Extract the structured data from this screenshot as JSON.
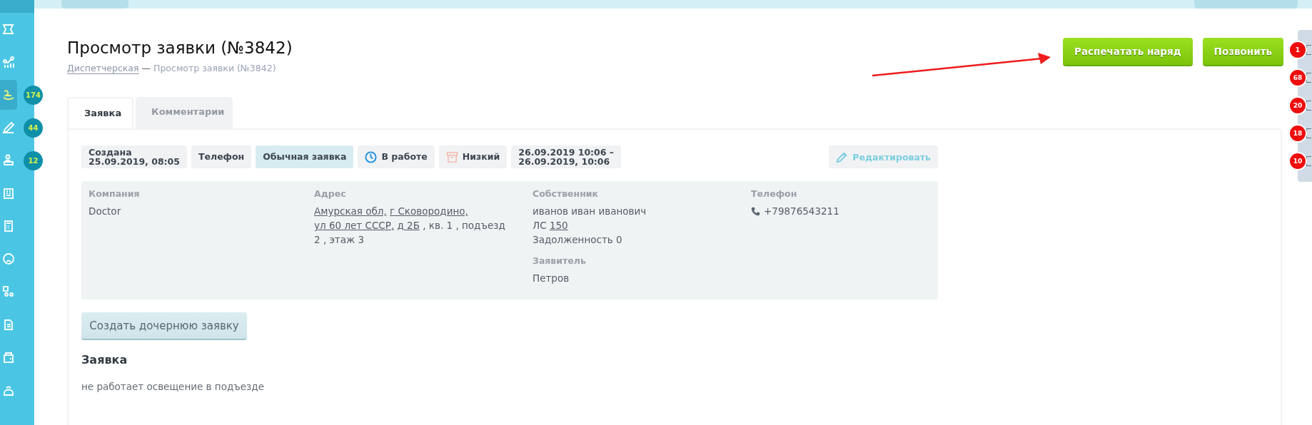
{
  "sidebar": {
    "items": [
      {
        "selected": false
      },
      {
        "selected": false
      },
      {
        "selected": true,
        "badge": "174"
      },
      {
        "selected": false,
        "badge": "44"
      },
      {
        "selected": false,
        "badge": "12"
      },
      {
        "selected": false
      },
      {
        "selected": false
      },
      {
        "selected": false
      },
      {
        "selected": false
      },
      {
        "selected": false
      },
      {
        "selected": false
      },
      {
        "selected": false
      }
    ]
  },
  "header": {
    "title": "Просмотр заявки (№3842)",
    "breadcrumb": {
      "link": "Диспетчерская",
      "separator": "—",
      "current": "Просмотр заявки (№3842)"
    },
    "buttons": [
      "Распечатать наряд",
      "Позвонить"
    ]
  },
  "tabs": [
    {
      "label": "Заявка",
      "selected": true
    },
    {
      "label": "Комментарии",
      "selected": false
    }
  ],
  "tags": [
    {
      "kind": "plain",
      "lines": [
        "Создана",
        "25.09.2019, 08:05"
      ]
    },
    {
      "kind": "plain",
      "lines": [
        "Телефон"
      ]
    },
    {
      "kind": "highlight",
      "lines": [
        "Обычная заявка"
      ]
    },
    {
      "kind": "status",
      "lines": [
        "В работе"
      ]
    },
    {
      "kind": "priority",
      "lines": [
        "Низкий"
      ]
    },
    {
      "kind": "plain",
      "lines": [
        "26.09.2019 10:06 –",
        "26.09.2019, 10:06"
      ]
    }
  ],
  "edit_button": "Редактировать",
  "info": {
    "company": {
      "label": "Компания",
      "value": "Doctor"
    },
    "address": {
      "label": "Адрес",
      "parts": [
        {
          "kind": "link",
          "text": "Амурская обл,"
        },
        {
          "kind": "link",
          "text": "г Сковородино,"
        },
        {
          "kind": "link",
          "text": "ул 60 лет СССР,"
        },
        {
          "kind": "link",
          "text": "д 2Б"
        },
        {
          "kind": "text",
          "text": ", кв. 1 , подъезд 2 , этаж 3"
        }
      ]
    },
    "owner": {
      "label": "Собственник",
      "name": "иванов иван иванович",
      "account_label": "ЛС",
      "account": "150",
      "debt": "Задолженность 0"
    },
    "applicant": {
      "label": "Заявитель",
      "value": "Петров"
    },
    "phone": {
      "label": "Телефон",
      "value": "+79876543211"
    }
  },
  "child_button": "Создать дочернюю заявку",
  "section": {
    "title": "Заявка",
    "text": "не работает освещение в подъезде"
  },
  "notifications": [
    {
      "count": "1"
    },
    {
      "count": "68"
    },
    {
      "count": "20"
    },
    {
      "count": "18"
    },
    {
      "count": "10"
    }
  ]
}
